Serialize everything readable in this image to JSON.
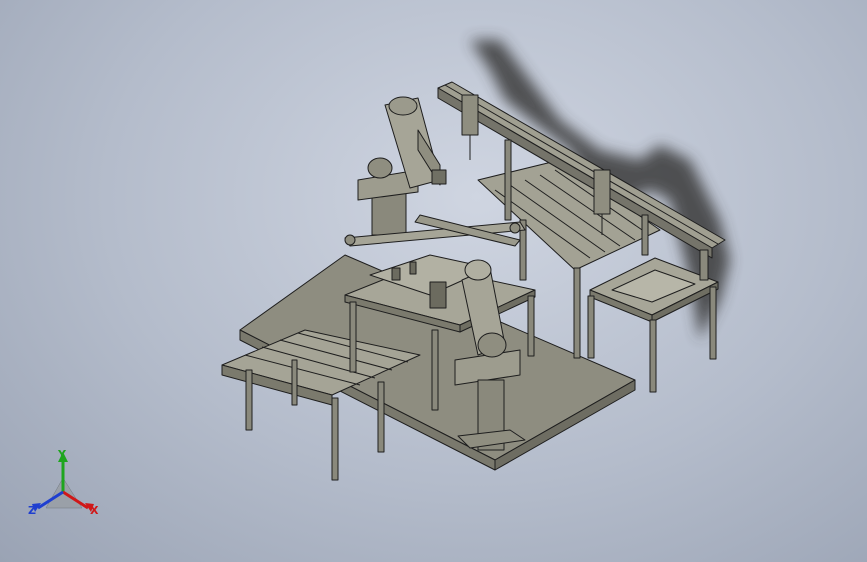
{
  "viewport": {
    "background": "gradient-blue-grey",
    "model_color": "#9b9a8c",
    "edge_color": "#1e1e1e",
    "shadow_color": "#3a3a3a"
  },
  "triad": {
    "x_label": "X",
    "y_label": "Y",
    "z_label": "Z",
    "x_color": "#d01818",
    "y_color": "#1ea51e",
    "z_color": "#1f3fd0"
  }
}
